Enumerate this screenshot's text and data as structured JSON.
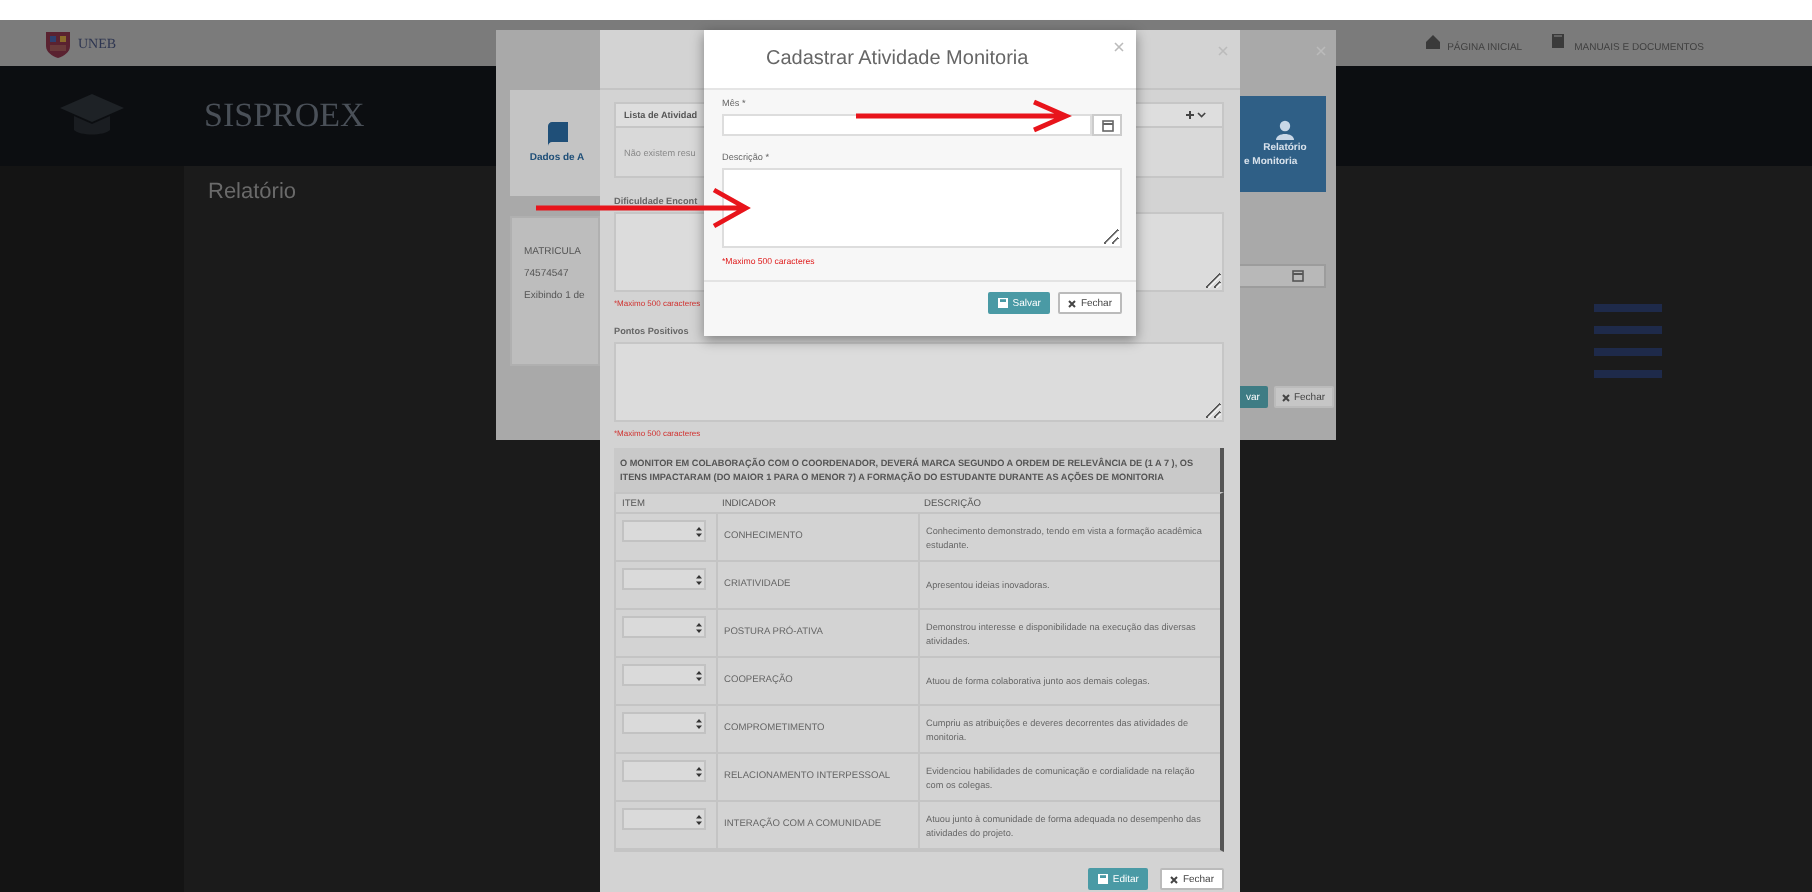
{
  "header": {
    "logo_text": "UNEB",
    "nav": [
      "PÁGINA INICIAL",
      "MANUAIS E DOCUMENTOS"
    ]
  },
  "banner": {
    "title": "SISPROEX"
  },
  "page_title": "Relatório",
  "report_modal": {
    "tab_label": "Dados de A",
    "card_lines": [
      "Relatório",
      "e Monitoria"
    ],
    "matricula_header": "MATRICULA",
    "matricula_value": "74574547",
    "footer_text": "Exibindo 1 de",
    "buttons": [
      {
        "label": "var",
        "kind": "primary"
      },
      {
        "label": "Fechar",
        "kind": "default"
      }
    ]
  },
  "evaluation_modal": {
    "activities_title": "Lista de Atividad",
    "activities_empty": "Não existem resu",
    "difficulty_label": "Dificuldade Encont",
    "difficulty_hint": "*Maximo 500 caracteres",
    "positives_label": "Pontos Positivos",
    "positives_hint": "*Maximo 500 caracteres",
    "notice": "O MONITOR EM COLABORAÇÃO COM O COORDENADOR, DEVERÁ MARCA **SEGUNDO A ORDEM DE RELEVÂNCIA DE (1 A 7 ), OS ITENS IMPACTARAM (DO MAIOR 1 PARA O MENOR 7)** A FORMAÇÃO DO ESTUDANTE DURANTE AS AÇÕES DE MONITORIA",
    "table": {
      "columns": [
        "ITEM",
        "INDICADOR",
        "DESCRIÇÃO"
      ],
      "rows": [
        {
          "indicator": "CONHECIMENTO",
          "description": "Conhecimento demonstrado, tendo em vista a formação acadêmica estudante."
        },
        {
          "indicator": "CRIATIVIDADE",
          "description": "Apresentou ideias inovadoras."
        },
        {
          "indicator": "POSTURA PRÓ-ATIVA",
          "description": "Demonstrou interesse e disponibilidade na execução das diversas atividades."
        },
        {
          "indicator": "COOPERAÇÃO",
          "description": "Atuou de forma colaborativa junto aos demais colegas."
        },
        {
          "indicator": "COMPROMETIMENTO",
          "description": "Cumpriu as atribuições e deveres decorrentes das atividades de monitoria."
        },
        {
          "indicator": "RELACIONAMENTO INTERPESSOAL",
          "description": "Evidenciou habilidades de comunicação e cordialidade na relação com os colegas."
        },
        {
          "indicator": "INTERAÇÃO COM A COMUNIDADE",
          "description": "Atuou junto à comunidade de forma adequada no desempenho das atividades do projeto."
        }
      ]
    },
    "buttons": [
      {
        "label": "Editar",
        "kind": "primary"
      },
      {
        "label": "Fechar",
        "kind": "default"
      }
    ]
  },
  "activity_modal": {
    "title": "Cadastrar Atividade Monitoria",
    "fields": [
      {
        "label": "Mês *",
        "kind": "date"
      },
      {
        "label": "Descrição *",
        "kind": "textarea",
        "hint": "*Maximo 500 caracteres"
      }
    ],
    "buttons": [
      {
        "label": "Salvar",
        "kind": "primary"
      },
      {
        "label": "Fechar",
        "kind": "default"
      }
    ]
  }
}
